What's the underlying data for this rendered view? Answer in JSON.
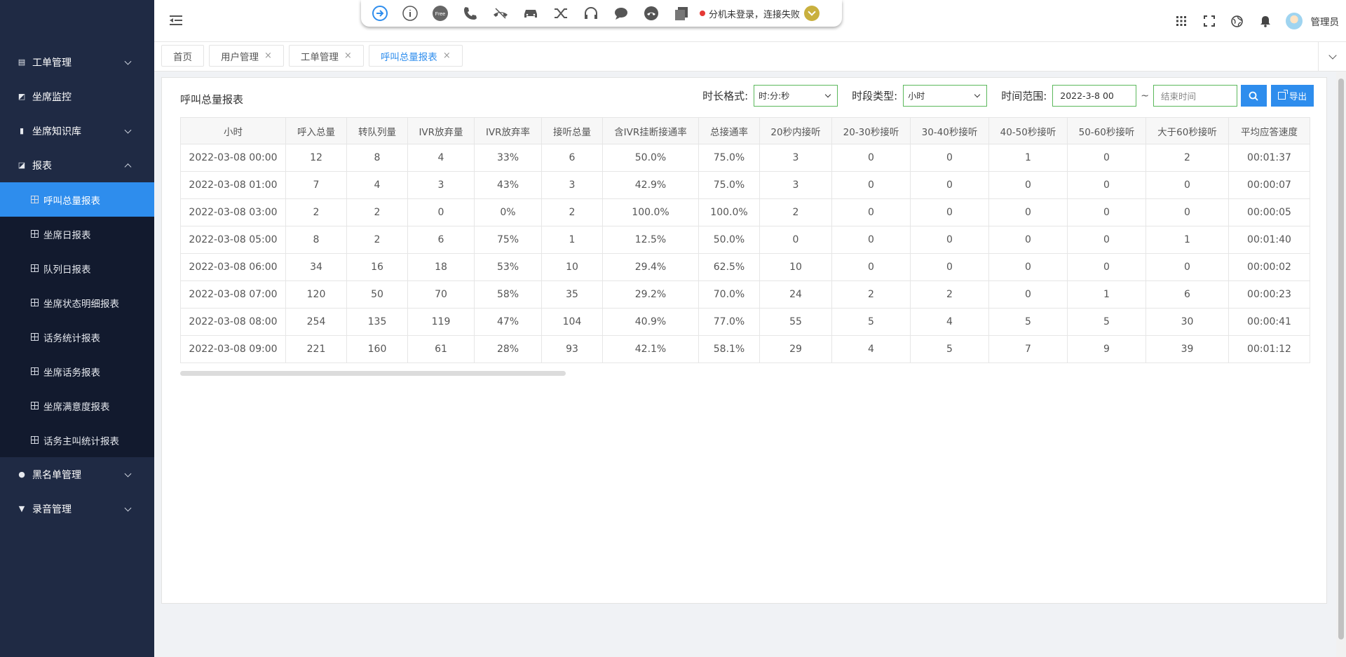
{
  "sidebar": {
    "items": [
      {
        "label": "工单管理",
        "icon": "list-icon",
        "expandable": true,
        "expanded": false
      },
      {
        "label": "坐席监控",
        "icon": "monitor-icon",
        "expandable": false
      },
      {
        "label": "坐席知识库",
        "icon": "book-icon",
        "expandable": true,
        "expanded": false
      },
      {
        "label": "报表",
        "icon": "chart-icon",
        "expandable": true,
        "expanded": true
      },
      {
        "label": "黑名单管理",
        "icon": "ban-icon",
        "expandable": true,
        "expanded": false
      },
      {
        "label": "录音管理",
        "icon": "recorder-icon",
        "expandable": true,
        "expanded": false
      }
    ],
    "report_subitems": [
      {
        "label": "呼叫总量报表",
        "active": true
      },
      {
        "label": "坐席日报表"
      },
      {
        "label": "队列日报表"
      },
      {
        "label": "坐席状态明细报表"
      },
      {
        "label": "话务统计报表"
      },
      {
        "label": "坐席话务报表"
      },
      {
        "label": "坐席满意度报表"
      },
      {
        "label": "话务主叫统计报表"
      }
    ],
    "colors": {
      "bg": "#1f2a44",
      "sub_bg": "#121a2e",
      "active": "#2e8ded"
    }
  },
  "softphone": {
    "buttons": [
      "sign-in-icon",
      "info-icon",
      "free-icon",
      "phone-icon",
      "hangup-icon",
      "car-icon",
      "transfer-icon",
      "headset-icon",
      "chat-icon",
      "hold-icon",
      "copy-icon"
    ],
    "free_label": "Free",
    "status_text": "分机未登录，连接失败",
    "status_color": "#e53935"
  },
  "header": {
    "username": "管理员",
    "icons": [
      "apps-grid-icon",
      "fullscreen-icon",
      "globe-icon",
      "bell-icon"
    ]
  },
  "tabs": [
    {
      "label": "首页",
      "closable": false,
      "active": false
    },
    {
      "label": "用户管理",
      "closable": true,
      "active": false
    },
    {
      "label": "工单管理",
      "closable": true,
      "active": false
    },
    {
      "label": "呼叫总量报表",
      "closable": true,
      "active": true
    }
  ],
  "tab_close_glyph": "×",
  "report": {
    "title": "呼叫总量报表",
    "filters": {
      "duration_format_label": "时长格式:",
      "duration_format_value": "时:分:秒",
      "period_type_label": "时段类型:",
      "period_type_value": "小时",
      "time_range_label": "时间范围:",
      "start_time": "2022-3-8 00",
      "separator": "~",
      "end_time_placeholder": "结束时间",
      "export_label": "导出"
    },
    "columns": [
      "小时",
      "呼入总量",
      "转队列量",
      "IVR放弃量",
      "IVR放弃率",
      "接听总量",
      "含IVR挂断接通率",
      "总接通率",
      "20秒内接听",
      "20-30秒接听",
      "30-40秒接听",
      "40-50秒接听",
      "50-60秒接听",
      "大于60秒接听",
      "平均应答速度"
    ],
    "rows": [
      [
        "2022-03-08 00:00",
        "12",
        "8",
        "4",
        "33%",
        "6",
        "50.0%",
        "75.0%",
        "3",
        "0",
        "0",
        "1",
        "0",
        "2",
        "00:01:37"
      ],
      [
        "2022-03-08 01:00",
        "7",
        "4",
        "3",
        "43%",
        "3",
        "42.9%",
        "75.0%",
        "3",
        "0",
        "0",
        "0",
        "0",
        "0",
        "00:00:07"
      ],
      [
        "2022-03-08 03:00",
        "2",
        "2",
        "0",
        "0%",
        "2",
        "100.0%",
        "100.0%",
        "2",
        "0",
        "0",
        "0",
        "0",
        "0",
        "00:00:05"
      ],
      [
        "2022-03-08 05:00",
        "8",
        "2",
        "6",
        "75%",
        "1",
        "12.5%",
        "50.0%",
        "0",
        "0",
        "0",
        "0",
        "0",
        "1",
        "00:01:40"
      ],
      [
        "2022-03-08 06:00",
        "34",
        "16",
        "18",
        "53%",
        "10",
        "29.4%",
        "62.5%",
        "10",
        "0",
        "0",
        "0",
        "0",
        "0",
        "00:00:02"
      ],
      [
        "2022-03-08 07:00",
        "120",
        "50",
        "70",
        "58%",
        "35",
        "29.2%",
        "70.0%",
        "24",
        "2",
        "2",
        "0",
        "1",
        "6",
        "00:00:23"
      ],
      [
        "2022-03-08 08:00",
        "254",
        "135",
        "119",
        "47%",
        "104",
        "40.9%",
        "77.0%",
        "55",
        "5",
        "4",
        "5",
        "5",
        "30",
        "00:00:41"
      ],
      [
        "2022-03-08 09:00",
        "221",
        "160",
        "61",
        "28%",
        "93",
        "42.1%",
        "58.1%",
        "29",
        "4",
        "5",
        "7",
        "9",
        "39",
        "00:01:12"
      ]
    ]
  }
}
